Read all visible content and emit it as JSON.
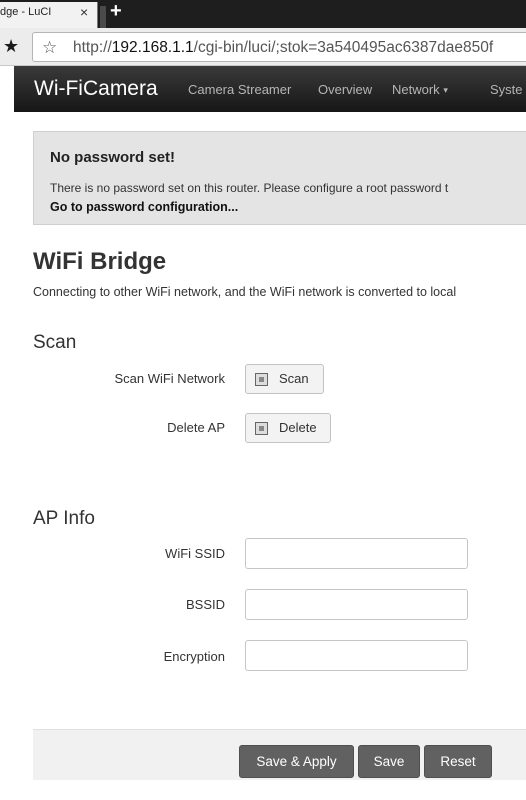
{
  "browser": {
    "tab_title": "dge - LuCI",
    "tab_close": "×",
    "new_tab": "+",
    "url_prefix": "http://",
    "url_host": "192.168.1.1",
    "url_path": "/cgi-bin/luci/;stok=3a540495ac6387dae850f",
    "bookmark_icon": "star-filled",
    "url_icon": "star-outline"
  },
  "nav": {
    "brand": "Wi-FiCamera",
    "items": [
      {
        "label": "Camera Streamer"
      },
      {
        "label": "Overview"
      },
      {
        "label": "Network",
        "caret": "▾"
      },
      {
        "label": "Syste"
      }
    ]
  },
  "alert": {
    "title": "No password set!",
    "text": "There is no password set on this router. Please configure a root password t",
    "link": "Go to password configuration..."
  },
  "page": {
    "title": "WiFi Bridge",
    "description": "Connecting to other WiFi network, and the WiFi network is converted to local"
  },
  "scan_section": {
    "title": "Scan",
    "scan_label": "Scan WiFi Network",
    "scan_button": "Scan",
    "delete_label": "Delete AP",
    "delete_button": "Delete"
  },
  "ap_info": {
    "title": "AP Info",
    "ssid_label": "WiFi SSID",
    "ssid_value": "",
    "bssid_label": "BSSID",
    "bssid_value": "",
    "encryption_label": "Encryption",
    "encryption_value": ""
  },
  "actions": {
    "save_apply": "Save & Apply",
    "save": "Save",
    "reset": "Reset"
  },
  "colors": {
    "navbar": "#222222",
    "action_button": "#616161",
    "alert_bg": "#e4e4e4"
  }
}
